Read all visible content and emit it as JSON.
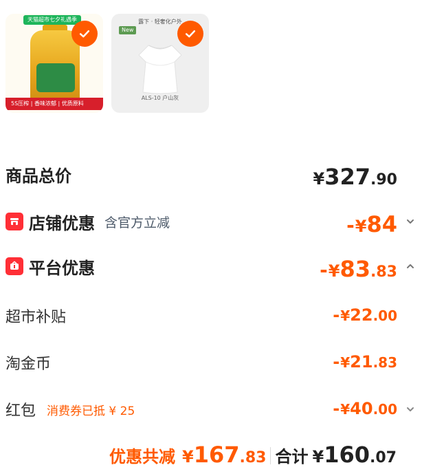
{
  "colors": {
    "accent": "#ff5a00",
    "red_icon": "#ff2f36",
    "oil_banner": "#1eb55b",
    "oil_strip": "#d71f2b",
    "text_dark": "#222222",
    "text_muted": "#4d5a6a"
  },
  "products": [
    {
      "top_banner": "天猫超市七夕礼遇季",
      "bottom_strip": "5S压榨 | 香味浓郁 | 优质原料",
      "icon": "check-icon"
    },
    {
      "new_tag": "New",
      "top_caption": "露下 · 轻奢化户外",
      "bottom_caption": "ALS-10 户山灰",
      "icon": "check-icon"
    }
  ],
  "summary": {
    "goods_total": {
      "label": "商品总价",
      "yen": "¥",
      "int": "327",
      "dec": ".90"
    },
    "shop_discount": {
      "label": "店铺优惠",
      "note": "含官方立减",
      "sign": "-",
      "yen": "¥",
      "int": "84",
      "icon": "shop-icon",
      "chevron": "chevron-down-icon"
    },
    "platform_discount": {
      "label": "平台优惠",
      "sign": "-",
      "yen": "¥",
      "int": "83",
      "dec": ".83",
      "icon": "platform-icon",
      "chevron": "chevron-up-icon"
    },
    "supermarket_subsidy": {
      "label": "超市补贴",
      "sign": "-",
      "yen": "¥",
      "int": "22",
      "dec": ".00"
    },
    "taojin_coin": {
      "label": "淘金币",
      "sign": "-",
      "yen": "¥",
      "int": "21",
      "dec": ".83"
    },
    "red_packet": {
      "label": "红包",
      "note": "消费券已抵 ¥ 25",
      "sign": "-",
      "yen": "¥",
      "int": "40",
      "dec": ".00",
      "chevron": "chevron-down-icon"
    }
  },
  "footer": {
    "discount_label": "优惠共减",
    "discount_yen": "¥",
    "discount_int": "167",
    "discount_dec": ".83",
    "total_label": "合计",
    "total_yen": "¥",
    "total_int": "160",
    "total_dec": ".07"
  }
}
